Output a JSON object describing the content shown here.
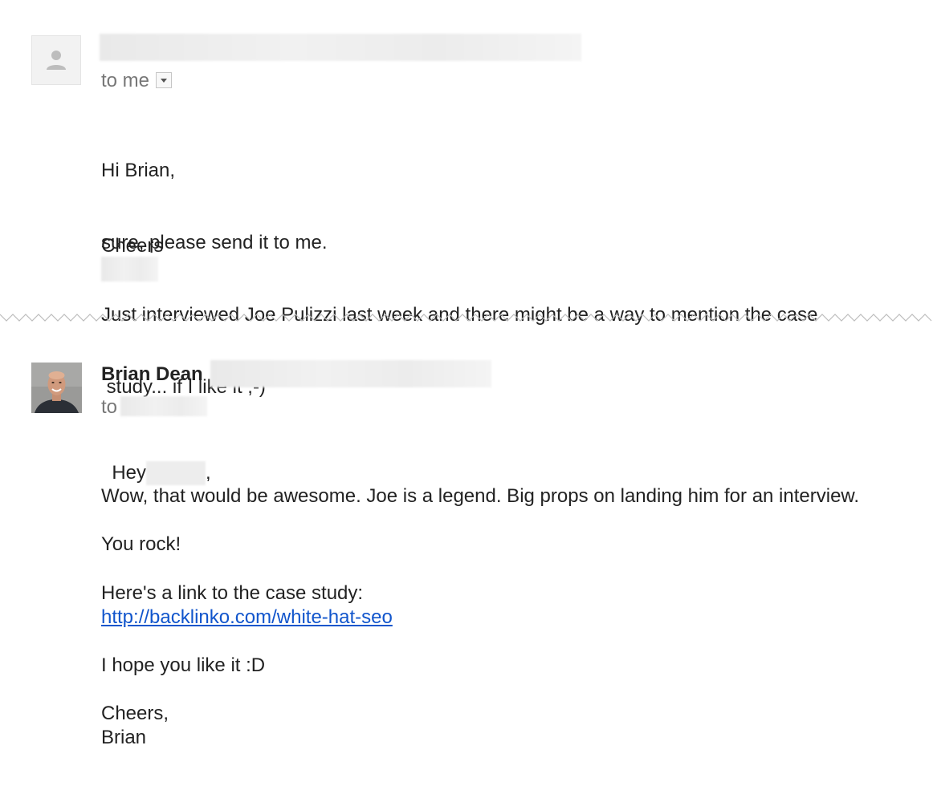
{
  "message1": {
    "avatar_icon": "person-icon",
    "recipient": "to me",
    "dropdown_icon": "chevron-down-icon",
    "body": {
      "greeting": "Hi Brian,",
      "line1": "sure, please send it to me.",
      "line2": "Just interviewed Joe Pulizzi last week and there might be a way to mention the case",
      "line3": " study... if I like it ;-)",
      "signoff": "Cheers"
    }
  },
  "message2": {
    "sender_name": "Brian Dean",
    "recipient_prefix": "to",
    "body": {
      "greeting_start": "Hey",
      "greeting_end": ",",
      "para1": "Wow, that would be awesome. Joe is a legend. Big props on landing him for an interview.",
      "para2": "You rock!",
      "para3": "Here's a link to the case study:",
      "link": "http://backlinko.com/white-hat-seo",
      "para4": "I hope you like it :D",
      "closing": "Cheers,",
      "signature": "Brian"
    }
  },
  "colors": {
    "text": "#222222",
    "muted": "#777777",
    "link": "#1155cc"
  }
}
